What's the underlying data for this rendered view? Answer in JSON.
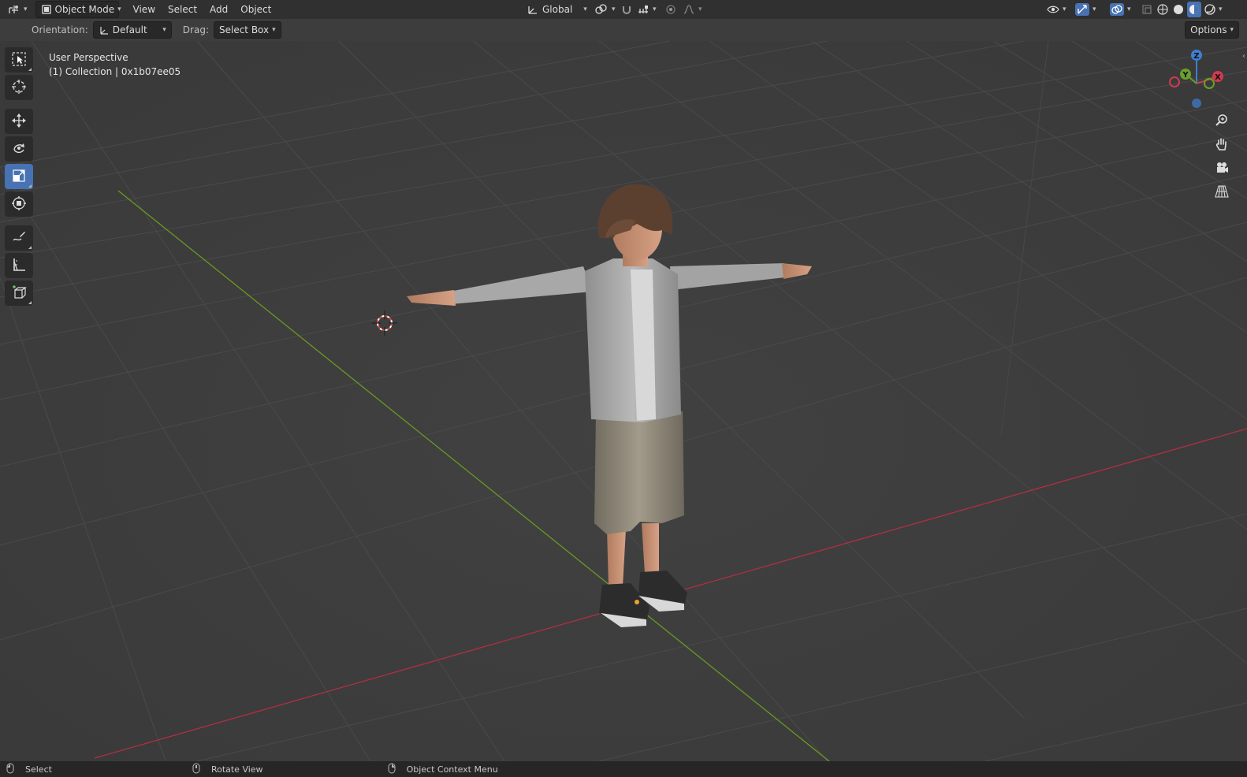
{
  "header": {
    "mode_label": "Object Mode",
    "menus": [
      "View",
      "Select",
      "Add",
      "Object"
    ],
    "transform_orientation": "Global",
    "options_label": "Options"
  },
  "tool_options": {
    "orientation_label": "Orientation:",
    "orientation_value": "Default",
    "drag_label": "Drag:",
    "drag_value": "Select Box"
  },
  "viewport": {
    "view_name": "User Perspective",
    "collection_info": "(1) Collection | 0x1b07ee05",
    "gizmo": {
      "z": "Z",
      "y": "Y",
      "x": "X"
    }
  },
  "toolbar": {
    "tools": [
      "select-box",
      "cursor",
      "move",
      "rotate",
      "scale",
      "transform",
      "annotate",
      "measure",
      "add-cube"
    ],
    "active": "scale"
  },
  "statusbar": {
    "items": [
      "Select",
      "Rotate View",
      "Object Context Menu"
    ]
  },
  "colors": {
    "accent": "#4772b3",
    "x_axis": "#b03040",
    "y_axis": "#6a9a22",
    "header_bg": "#303030",
    "viewport_bg": "#3d3d3d"
  }
}
